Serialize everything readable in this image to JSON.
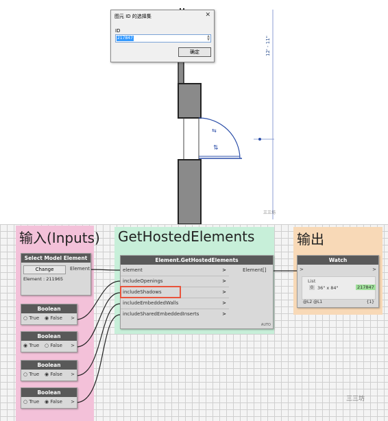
{
  "revit": {
    "dialog": {
      "title": "图元 ID 的选择集",
      "close": "✕",
      "id_label": "ID",
      "id_value": "217847",
      "ok_button": "确定"
    },
    "dimension": "12' - 11\"",
    "watermark": "三三坊"
  },
  "dynamo": {
    "groups": {
      "inputs": "输入(Inputs)",
      "main": "GetHostedElements",
      "output": "输出"
    },
    "select_node": {
      "title": "Select Model Element",
      "change_button": "Change",
      "output_port": "Element",
      "info": "Element : 211965"
    },
    "booleans": [
      {
        "title": "Boolean",
        "true_label": "True",
        "false_label": "False",
        "selected": "False",
        "arrow": ">"
      },
      {
        "title": "Boolean",
        "true_label": "True",
        "false_label": "False",
        "selected": "True",
        "arrow": ">"
      },
      {
        "title": "Boolean",
        "true_label": "True",
        "false_label": "False",
        "selected": "False",
        "arrow": ">"
      },
      {
        "title": "Boolean",
        "true_label": "True",
        "false_label": "False",
        "selected": "False",
        "arrow": ">"
      }
    ],
    "hosted_node": {
      "title": "Element.GetHostedElements",
      "inputs": [
        "element",
        "includeOpenings",
        "includeShadows",
        "includeEmbeddedWalls",
        "includeSharedEmbeddedInserts"
      ],
      "output": "Element[]",
      "lacing": "AUTO",
      "arrow": ">"
    },
    "watch_node": {
      "title": "Watch",
      "in_arrow": ">",
      "out_arrow": ">",
      "list_label": "List",
      "index": "0",
      "item_text": "36\" x 84\"",
      "item_value": "217847",
      "footer_left": "@L2 @L1",
      "footer_right": "{1}"
    },
    "watermark": "三三坊",
    "colors": {
      "inputs_group": "#f3c1d9",
      "main_group": "#c7efd9",
      "output_group": "#f8d9b7",
      "highlight": "#e8533b",
      "watch_value": "#9fe09a"
    }
  }
}
